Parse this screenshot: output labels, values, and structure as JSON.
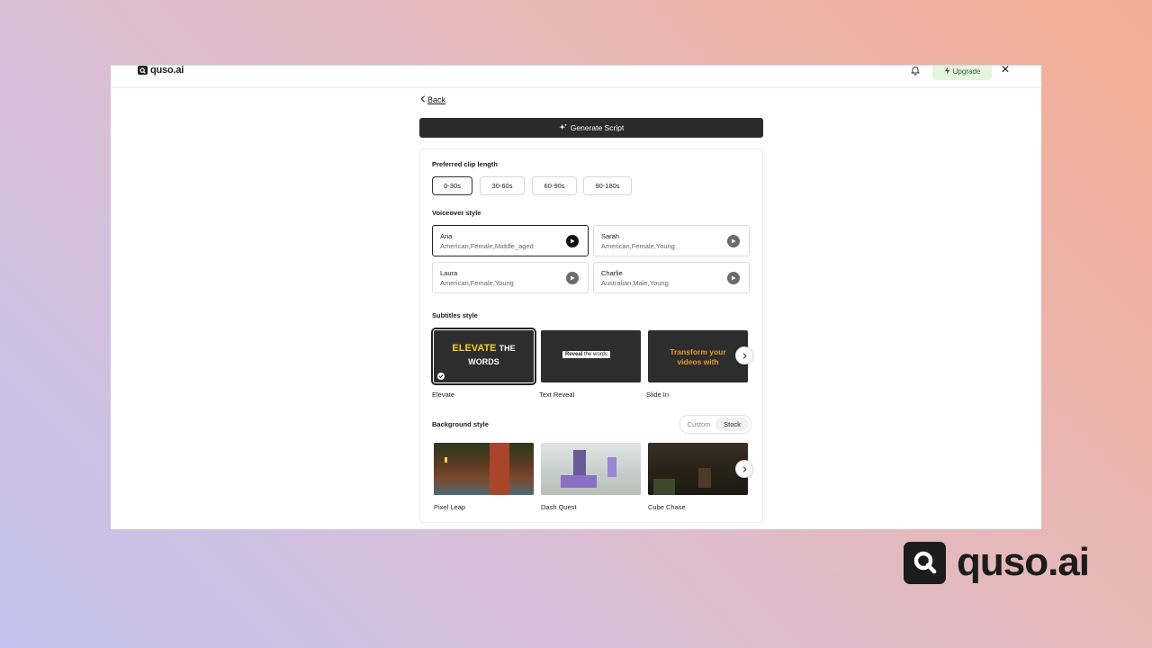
{
  "brand": {
    "name": "quso.ai"
  },
  "topbar": {
    "upgrade_label": "Upgrade",
    "close_glyph": "✕"
  },
  "nav": {
    "back_label": "Back"
  },
  "generate": {
    "label": "Generate Script"
  },
  "clip_length": {
    "title": "Preferred clip length",
    "options": [
      "0-30s",
      "30-60s",
      "60-90s",
      "90-180s"
    ],
    "selected": "0-30s"
  },
  "voiceover": {
    "title": "Voiceover style",
    "voices": [
      {
        "name": "Aria",
        "desc": "American,Female,Middle_aged",
        "selected": true
      },
      {
        "name": "Sarah",
        "desc": "American,Female,Young",
        "selected": false
      },
      {
        "name": "Laura",
        "desc": "American,Female,Young",
        "selected": false
      },
      {
        "name": "Charlie",
        "desc": "Australian,Male,Young",
        "selected": false
      }
    ]
  },
  "subtitles": {
    "title": "Subtitles style",
    "items": [
      {
        "label": "Elevate",
        "preview_main": "ELEVATE",
        "preview_rest": "THE",
        "preview_line2": "WORDS",
        "selected": true
      },
      {
        "label": "Text Reveal",
        "preview_highlight": "Reveal",
        "preview_rest": "the words"
      },
      {
        "label": "Slide In",
        "preview_line1": "Transform your",
        "preview_line2": "videos with"
      }
    ]
  },
  "background": {
    "title": "Background style",
    "toggle": [
      "Custom",
      "Stock"
    ],
    "toggle_selected": "Stock",
    "items": [
      {
        "label": "Pixel Leap"
      },
      {
        "label": "Dash Quest"
      },
      {
        "label": "Cube Chase"
      }
    ]
  },
  "icons": {
    "logo": "quso-logo-icon",
    "bell": "bell-icon",
    "bolt": "lightning-icon",
    "back": "chevron-left-icon",
    "sparkle": "sparkle-icon",
    "play": "play-icon",
    "next": "chevron-right-icon",
    "check": "check-icon"
  },
  "colors": {
    "primary_button": "#2b2b27",
    "upgrade_bg": "#e4f5e0",
    "elevate_yellow": "#f5d020",
    "slide_orange": "#e69a2c"
  }
}
